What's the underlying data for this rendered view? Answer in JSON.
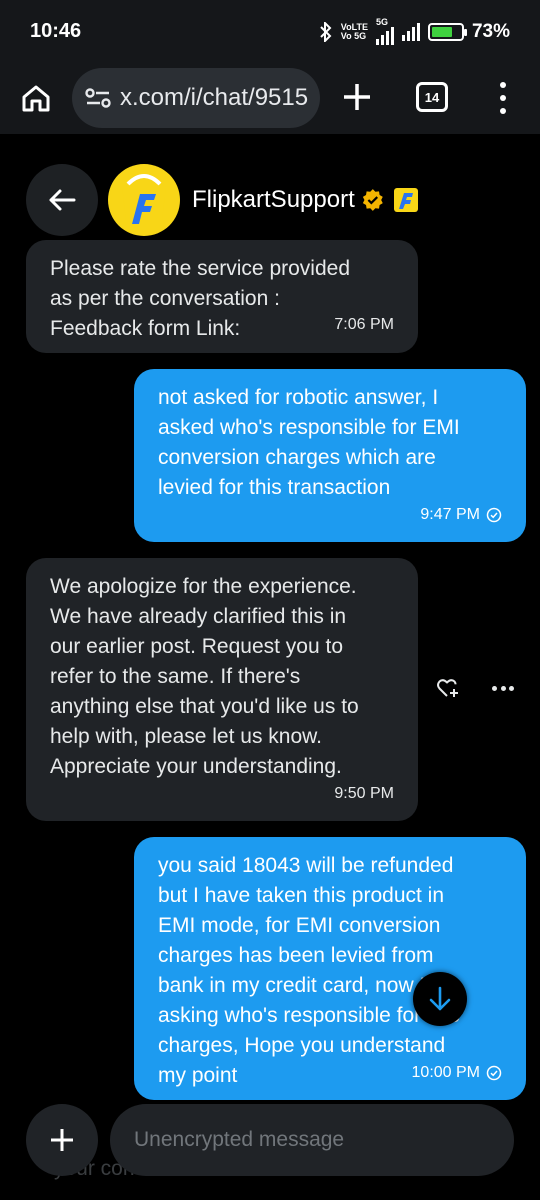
{
  "status_bar": {
    "time": "10:46",
    "network_line1": "VoLTE",
    "network_line2": "Vo 5G",
    "network_type": "5G",
    "battery": "73%",
    "battery_level": 0.73,
    "icons": [
      "bluetooth-icon",
      "signal-icon",
      "battery-icon"
    ]
  },
  "browser": {
    "url": "x.com/i/chat/9515",
    "tab_count": "14",
    "icons": [
      "home-icon",
      "site-settings-icon",
      "new-tab-icon",
      "tabs-icon",
      "menu-icon"
    ]
  },
  "chat": {
    "contact_name": "FlipkartSupport",
    "icons": [
      "back-arrow-icon",
      "verified-badge-icon",
      "flipkart-logo-icon"
    ]
  },
  "messages": [
    {
      "direction": "incoming",
      "text": "Please rate the service provided\nas per the conversation :\nFeedback form Link:",
      "time": "7:06 PM"
    },
    {
      "direction": "outgoing",
      "text": "not asked for robotic answer, I\nasked who's responsible for EMI\nconversion charges which are\nlevied for this transaction",
      "time": "9:47 PM",
      "status": "read"
    },
    {
      "direction": "incoming",
      "text": "We apologize for the experience.\nWe have already clarified this in\nour earlier post. Request you to\nrefer to the same. If there's\nanything else that you'd like us to\nhelp with, please let us know.\nAppreciate your understanding.",
      "time": "9:50 PM"
    },
    {
      "direction": "outgoing",
      "text": "you said 18043 will be refunded\nbut I have taken this product in\nEMI mode, for EMI conversion\ncharges has been levied from\nbank in my credit card, now I am\nasking who's responsible for this\ncharges, Hope you understand\nmy point",
      "time": "10:00 PM",
      "status": "read"
    }
  ],
  "composer": {
    "placeholder": "Unencrypted message",
    "behind_text": "your concern related to the order",
    "icons": [
      "add-icon",
      "scroll-down-icon"
    ]
  },
  "colors": {
    "outgoing_bubble": "#1d9bf0",
    "incoming_bubble": "#202327",
    "background": "#000000",
    "verified": "#f4b400"
  }
}
